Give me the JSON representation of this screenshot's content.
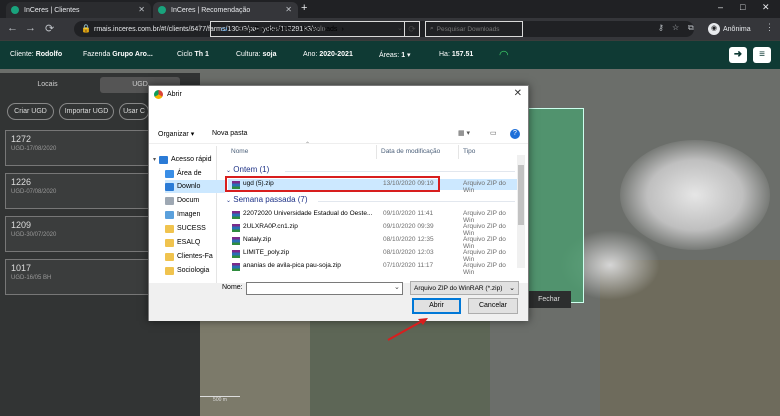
{
  "browser": {
    "tabs": [
      {
        "label": "InCeres | Clientes"
      },
      {
        "label": "InCeres | Recomendação"
      }
    ],
    "url": "rmais.inceres.com.br/#!/clients/6477/farms/13009/pa-cycles/11229133/solo",
    "profile": "Anônima",
    "new_tab": "+",
    "win_controls": [
      "–",
      "□",
      "✕"
    ]
  },
  "app_header": {
    "cliente_label": "Cliente:",
    "cliente_value": "Rodolfo",
    "fazenda_label": "Fazenda",
    "fazenda_value": "Grupo Aro...",
    "ciclo_label": "Ciclo",
    "ciclo_value": "Th 1",
    "cultura_label": "Cultura:",
    "cultura_value": "soja",
    "ano_label": "Ano:",
    "ano_value": "2020-2021",
    "areas_label": "Áreas:",
    "areas_value": "1",
    "ha_label": "Ha:",
    "ha_value": "157.51"
  },
  "sidebar": {
    "tabs": [
      "Locais",
      "UGD"
    ],
    "buttons": [
      "Criar UGD",
      "Importar UGD",
      "Usar C"
    ],
    "cards": [
      {
        "number": "1272",
        "date": "UGD-17/08/2020"
      },
      {
        "number": "1226",
        "date": "UGD-07/08/2020"
      },
      {
        "number": "1209",
        "date": "UGD-30/07/2020"
      },
      {
        "number": "1017",
        "date": "UGD-16/05 BH"
      }
    ]
  },
  "map": {
    "fechar": "Fechar",
    "scale": "500 m"
  },
  "dialog": {
    "title": "Abrir",
    "close": "✕",
    "path": [
      "Este Computador",
      "Downloads"
    ],
    "search_placeholder": "Pesquisar Downloads",
    "organizar": "Organizar",
    "nova_pasta": "Nova pasta",
    "help": "?",
    "nav": [
      {
        "label": "Acesso rápid",
        "color": "#2b7bd6"
      },
      {
        "label": "Área de",
        "color": "#3a8ee6"
      },
      {
        "label": "Downlo",
        "color": "#2b7bd6"
      },
      {
        "label": "Docum",
        "color": "#9ea8b3"
      },
      {
        "label": "Imagen",
        "color": "#5aa0dc"
      },
      {
        "label": "SUCESS",
        "color": "#f0c34e"
      },
      {
        "label": "ESALQ",
        "color": "#f0c34e"
      },
      {
        "label": "Clientes-Fa",
        "color": "#f0c34e"
      },
      {
        "label": "Sociologia",
        "color": "#f0c34e"
      }
    ],
    "columns": {
      "name": "Nome",
      "date": "Data de modificação",
      "type": "Tipo"
    },
    "groups": [
      {
        "label": "Ontem (1)",
        "files": [
          {
            "name": "ugd (5).zip",
            "date": "13/10/2020 09:19",
            "type": "Arquivo ZIP do Win"
          }
        ]
      },
      {
        "label": "Semana passada (7)",
        "files": [
          {
            "name": "22072020 Universidade Estadual do Oeste...",
            "date": "09/10/2020 11:41",
            "type": "Arquivo ZIP do Win"
          },
          {
            "name": "2ULXRA0P.cn1.zip",
            "date": "09/10/2020 09:39",
            "type": "Arquivo ZIP do Win"
          },
          {
            "name": "Nataly.zip",
            "date": "08/10/2020 12:35",
            "type": "Arquivo ZIP do Win"
          },
          {
            "name": "LIMITE_poly.zip",
            "date": "08/10/2020 12:03",
            "type": "Arquivo ZIP do Win"
          },
          {
            "name": "ananias de avila-pica pau-soja.zip",
            "date": "07/10/2020 11:17",
            "type": "Arquivo ZIP do Win"
          }
        ]
      }
    ],
    "filename_label": "Nome:",
    "filename_value": "",
    "filetype": "Arquivo ZIP do WinRAR (*.zip)",
    "open_label": "Abrir",
    "cancel_label": "Cancelar"
  },
  "colors": {
    "header_bg": "#0f3a34",
    "highlight_red": "#d81e1e",
    "accent_blue": "#0078d7"
  }
}
